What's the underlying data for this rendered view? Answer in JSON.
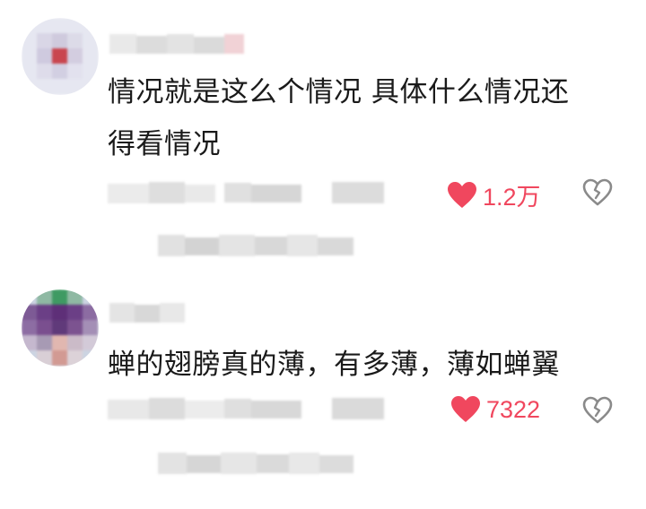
{
  "comments": [
    {
      "text_line1": "情况就是这么个情况 具体什么情况还",
      "text_line2": "得看情况",
      "likes": "1.2万",
      "like_icon": "heart-icon",
      "dislike_icon": "broken-heart-icon"
    },
    {
      "text_line1": "蝉的翅膀真的薄，有多薄，薄如蝉翼",
      "likes": "7322",
      "like_icon": "heart-icon",
      "dislike_icon": "broken-heart-icon"
    }
  ],
  "colors": {
    "like": "#f0475e",
    "dislike_outline": "#8a8a8a",
    "text": "#1a1a1a",
    "mosaic_gray": "#d9d9d9"
  }
}
